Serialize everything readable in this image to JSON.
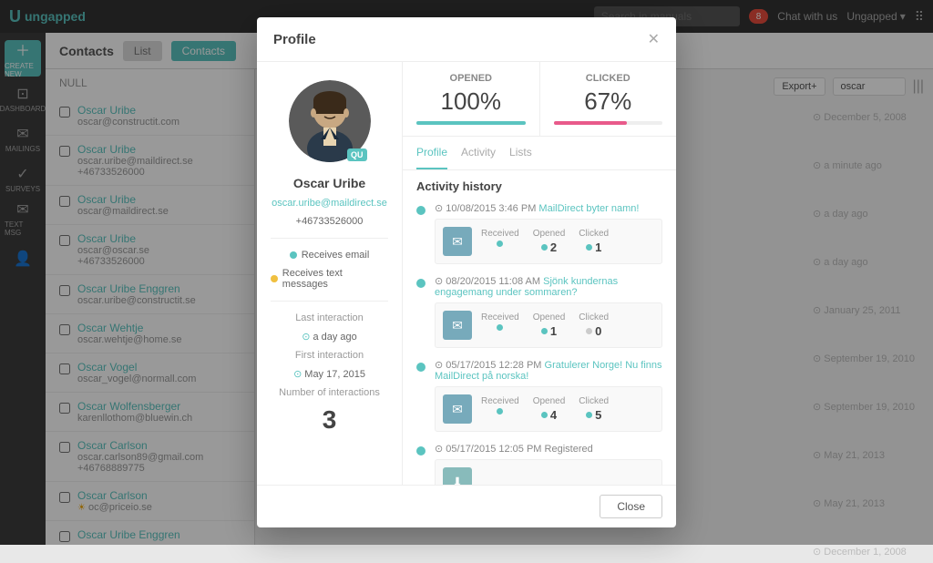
{
  "app": {
    "logo": "ungapped",
    "logo_u": "U"
  },
  "topbar": {
    "search_placeholder": "Search in manuals",
    "notifications_count": "8",
    "chat_label": "Chat with us",
    "account_label": "Ungapped",
    "account_arrow": "▾"
  },
  "sidebar": {
    "items": [
      {
        "id": "create",
        "label": "CREATE NEW",
        "icon": "+"
      },
      {
        "id": "dashboard",
        "label": "DASHBOARD",
        "icon": "◫"
      },
      {
        "id": "mailings",
        "label": "MAILINGS",
        "icon": "✉"
      },
      {
        "id": "surveys",
        "label": "SURVEYS",
        "icon": "✓"
      },
      {
        "id": "text",
        "label": "TEXT MESSAGE",
        "icon": "✉"
      },
      {
        "id": "contacts",
        "label": "CONTACTS",
        "icon": "👤"
      }
    ]
  },
  "contacts": {
    "title": "Contacts",
    "tabs": [
      {
        "id": "list",
        "label": "List",
        "active": false
      },
      {
        "id": "contacts",
        "label": "Contacts",
        "active": true
      }
    ],
    "list": [
      {
        "name": "NULL",
        "email": "",
        "phone": ""
      },
      {
        "name": "Oscar Uribe",
        "email": "oscar@constructit.com",
        "phone": ""
      },
      {
        "name": "Oscar Uribe",
        "email": "oscar.uribe@maildirect.se",
        "phone": "+46733526000"
      },
      {
        "name": "Oscar Uribe",
        "email": "oscar@maildirect.se",
        "phone": ""
      },
      {
        "name": "Oscar Uribe",
        "email": "oscar@oscar.se",
        "phone": "+46733526000"
      },
      {
        "name": "Oscar Uribe Enggren",
        "email": "oscar.uribe@constructit.se",
        "phone": ""
      },
      {
        "name": "Oscar Wehtje",
        "email": "oscar.wehtje@home.se",
        "phone": ""
      },
      {
        "name": "Oscar Vogel",
        "email": "oscar_vogel@normall.com",
        "phone": ""
      },
      {
        "name": "Oscar Wolfensberger",
        "email": "karenllothom@bluewin.ch",
        "phone": ""
      },
      {
        "name": "Oscar Carlson",
        "email": "oscar.carlson89@gmail.com",
        "phone": "+46768889775"
      },
      {
        "name": "Oscar Carlson",
        "email": "oc@priceio.se",
        "phone": ""
      },
      {
        "name": "Oscar Uribe Enggren",
        "email": "",
        "phone": ""
      }
    ],
    "right_dates": [
      "December 5, 2008",
      "a minute ago",
      "a day ago",
      "a day ago",
      "January 25, 2011",
      "September 19, 2010",
      "September 19, 2010",
      "May 21, 2013",
      "May 21, 2013",
      "December 1, 2008"
    ],
    "actions": {
      "export_label": "Export+",
      "filter_value": "oscar",
      "cols_icon": "|||"
    }
  },
  "modal": {
    "title": "Profile",
    "close_x": "✕",
    "profile": {
      "avatar_initials": "QU",
      "name": "Oscar Uribe",
      "email": "oscar.uribe@maildirect.se",
      "phone": "+46733526000",
      "receives_email": "Receives email",
      "receives_sms": "Receives text messages",
      "last_interaction_label": "Last interaction",
      "last_interaction_val": "a day ago",
      "first_interaction_label": "First interaction",
      "first_interaction_date": "May 17, 2015",
      "interactions_label": "Number of interactions",
      "interactions_count": "3"
    },
    "stats": {
      "opened_label": "Opened",
      "opened_val": "100%",
      "opened_pct": 100,
      "clicked_label": "Clicked",
      "clicked_val": "67%",
      "clicked_pct": 67
    },
    "tabs": [
      {
        "id": "profile",
        "label": "Profile",
        "active": true
      },
      {
        "id": "activity",
        "label": "Activity",
        "active": false
      },
      {
        "id": "lists",
        "label": "Lists",
        "active": false
      }
    ],
    "activity": {
      "section_title": "Activity history",
      "items": [
        {
          "date": "10/08/2015 3:46 PM",
          "subject": "MailDirect byter namn!",
          "received_label": "Received",
          "received_val": "",
          "opened_label": "Opened",
          "opened_val": "2",
          "clicked_label": "Clicked",
          "clicked_val": "1",
          "opened_dot": "green",
          "clicked_dot": "green"
        },
        {
          "date": "08/20/2015 11:08 AM",
          "subject": "Sjönk kundernas engagemang under sommaren?",
          "received_label": "Received",
          "received_val": "",
          "opened_label": "Opened",
          "opened_val": "1",
          "clicked_label": "Clicked",
          "clicked_val": "0",
          "opened_dot": "green",
          "clicked_dot": "gray"
        },
        {
          "date": "05/17/2015 12:28 PM",
          "subject": "Gratulerar Norge! Nu finns MailDirect på norska!",
          "received_label": "Received",
          "received_val": "",
          "opened_label": "Opened",
          "opened_val": "4",
          "clicked_label": "Clicked",
          "clicked_val": "5",
          "opened_dot": "green",
          "clicked_dot": "green"
        },
        {
          "date": "05/17/2015 12:05 PM",
          "subject": "Registered",
          "type": "registered"
        }
      ]
    },
    "footer": {
      "close_label": "Close"
    }
  }
}
